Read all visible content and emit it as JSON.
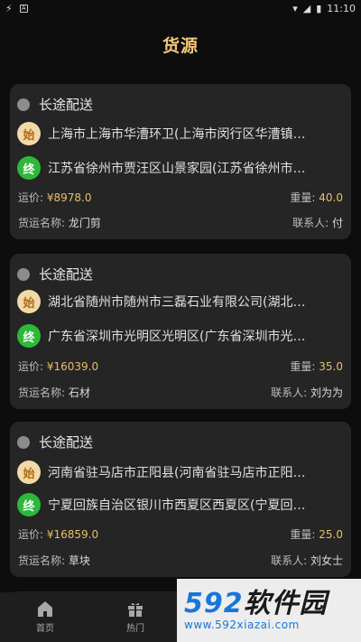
{
  "status_bar": {
    "time": "11:10",
    "left_icons": [
      "lightning-icon",
      "a-icon"
    ],
    "right_icons": [
      "wifi-icon",
      "signal-icon",
      "battery-icon"
    ]
  },
  "header": {
    "title": "货源"
  },
  "cards": [
    {
      "type": "长途配送",
      "start_badge": "始",
      "end_badge": "终",
      "from": "上海市上海市华漕环卫(上海市闵行区华漕镇…",
      "to": "江苏省徐州市贾汪区山景家园(江苏省徐州市…",
      "price_label": "运价: ",
      "price": "¥8978.0",
      "weight_label": "重量: ",
      "weight": "40.0",
      "goods_label": "货运名称: ",
      "goods": "龙门剪",
      "contact_label": "联系人: ",
      "contact": "付"
    },
    {
      "type": "长途配送",
      "start_badge": "始",
      "end_badge": "终",
      "from": "湖北省随州市随州市三磊石业有限公司(湖北…",
      "to": "广东省深圳市光明区光明区(广东省深圳市光…",
      "price_label": "运价: ",
      "price": "¥16039.0",
      "weight_label": "重量: ",
      "weight": "35.0",
      "goods_label": "货运名称: ",
      "goods": "石材",
      "contact_label": "联系人: ",
      "contact": "刘为为"
    },
    {
      "type": "长途配送",
      "start_badge": "始",
      "end_badge": "终",
      "from": "河南省驻马店市正阳县(河南省驻马店市正阳…",
      "to": "宁夏回族自治区银川市西夏区西夏区(宁夏回…",
      "price_label": "运价: ",
      "price": "¥16859.0",
      "weight_label": "重量: ",
      "weight": "25.0",
      "goods_label": "货运名称: ",
      "goods": "草块",
      "contact_label": "联系人: ",
      "contact": "刘女士"
    }
  ],
  "bottom_nav": [
    {
      "label": "首页",
      "icon": "home-icon"
    },
    {
      "label": "热门",
      "icon": "gift-icon"
    }
  ],
  "watermark": {
    "brand_digits": "592",
    "brand_cn": "软件园",
    "url": "www.592xiazai.com"
  },
  "colors": {
    "accent": "#f4c67a",
    "card": "#252525",
    "start": "#f3d9a8",
    "end": "#2eb83a",
    "bg": "#0d0d0d"
  }
}
